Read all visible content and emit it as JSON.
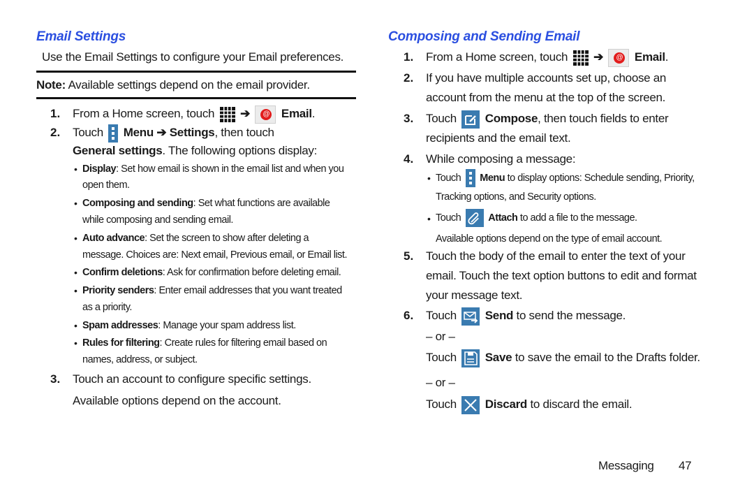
{
  "left": {
    "title": "Email Settings",
    "intro": "Use the Email Settings to configure your Email preferences.",
    "note_label": "Note:",
    "note_text": " Available settings depend on the email provider.",
    "step1": {
      "num": "1.",
      "pre": "From a Home screen, touch",
      "arrow": "➔",
      "bold": "Email",
      "post": "."
    },
    "step2": {
      "num": "2.",
      "pre": "Touch",
      "bold1": "Menu",
      "arrow": "➔",
      "bold2": "Settings",
      "post": ", then touch",
      "line2_bold": "General settings",
      "line2_post": ". The following options display:"
    },
    "bullets": [
      {
        "bold": "Display",
        "text": ": Set how email is shown in the email list and when you",
        "cont": "open them."
      },
      {
        "bold": "Composing and sending",
        "text": ": Set what functions are available",
        "cont": "while composing and sending email."
      },
      {
        "bold": "Auto advance",
        "text": ": Set the screen to show after deleting a",
        "cont": "message. Choices are: Next email, Previous email, or Email list."
      },
      {
        "bold": "Confirm deletions",
        "text": ": Ask for confirmation before deleting email.",
        "cont": ""
      },
      {
        "bold": "Priority senders",
        "text": ": Enter email addresses that you want treated",
        "cont": "as a priority."
      },
      {
        "bold": "Spam addresses",
        "text": ": Manage your spam address list.",
        "cont": ""
      },
      {
        "bold": "Rules for filtering",
        "text": ": Create rules for filtering email based on",
        "cont": "names, address, or subject."
      }
    ],
    "step3": {
      "num": "3.",
      "line1": "Touch an account to configure specific settings.",
      "line2": "Available options depend on the account."
    }
  },
  "right": {
    "title": "Composing and Sending Email",
    "step1": {
      "num": "1.",
      "pre": "From a Home screen, touch",
      "arrow": "➔",
      "bold": "Email",
      "post": "."
    },
    "step2": {
      "num": "2.",
      "line1": "If you have multiple accounts set up, choose an",
      "line2": "account from the menu at the top of the screen."
    },
    "step3": {
      "num": "3.",
      "pre": "Touch",
      "bold": "Compose",
      "post": ", then touch fields to enter",
      "line2": "recipients and the email text."
    },
    "step4": {
      "num": "4.",
      "text": "While composing a message:"
    },
    "bullet_menu": {
      "pre": "Touch",
      "bold": "Menu",
      "post": " to display options: Schedule sending, Priority,",
      "cont": "Tracking options, and Security options."
    },
    "bullet_attach": {
      "pre": "Touch",
      "bold": "Attach",
      "post": " to add a file to the message."
    },
    "attach_note": "Available options depend on the type of email account.",
    "step5": {
      "num": "5.",
      "line1": "Touch the body of the email to enter the text of your",
      "line2": "email. Touch the text option buttons to edit and format",
      "line3": "your message text."
    },
    "step6": {
      "num": "6.",
      "pre": "Touch",
      "bold": "Send",
      "post": " to send the message."
    },
    "or1": "– or –",
    "save": {
      "pre": "Touch",
      "bold": "Save",
      "post": " to save the email to the Drafts folder."
    },
    "or2": "– or –",
    "discard": {
      "pre": "Touch",
      "bold": "Discard",
      "post": " to discard the email."
    }
  },
  "footer": {
    "section": "Messaging",
    "page": "47"
  },
  "colors": {
    "heading": "#2b4fe0",
    "icon_blue": "#3a7bb0",
    "email_red": "#e21d1d"
  }
}
